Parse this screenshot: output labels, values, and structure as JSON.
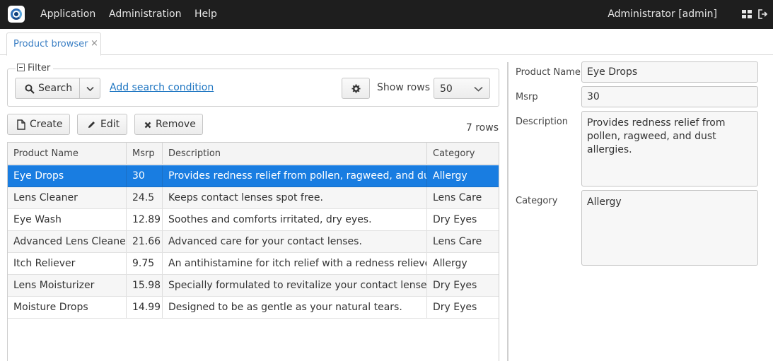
{
  "topbar": {
    "menu": [
      "Application",
      "Administration",
      "Help"
    ],
    "user": "Administrator [admin]"
  },
  "tabs": [
    {
      "label": "Product browser",
      "close": "×"
    }
  ],
  "filter": {
    "legend": "Filter",
    "search_label": "Search",
    "add_condition": "Add search condition",
    "show_rows_label": "Show rows",
    "show_rows_value": "50"
  },
  "actions": {
    "create": "Create",
    "edit": "Edit",
    "remove": "Remove"
  },
  "rows_count": "7 rows",
  "table": {
    "columns": [
      "Product Name",
      "Msrp",
      "Description",
      "Category"
    ],
    "rows": [
      [
        "Eye Drops",
        "30",
        "Provides redness relief from pollen, ragweed, and dust allergies.",
        "Allergy"
      ],
      [
        "Lens Cleaner",
        "24.5",
        "Keeps contact lenses spot free.",
        "Lens Care"
      ],
      [
        "Eye Wash",
        "12.89",
        "Soothes and comforts irritated, dry eyes.",
        "Dry Eyes"
      ],
      [
        "Advanced Lens Cleaner",
        "21.66",
        "Advanced care for your contact lenses.",
        "Lens Care"
      ],
      [
        "Itch Reliever",
        "9.75",
        "An antihistamine for itch relief with a redness reliever.",
        "Allergy"
      ],
      [
        "Lens Moisturizer",
        "15.98",
        "Specially formulated to revitalize your contact lenses.",
        "Dry Eyes"
      ],
      [
        "Moisture Drops",
        "14.99",
        "Designed to be as gentle as your natural tears.",
        "Dry Eyes"
      ]
    ],
    "selected_row": 0
  },
  "form": {
    "name_label": "Product Name",
    "name_value": "Eye Drops",
    "msrp_label": "Msrp",
    "msrp_value": "30",
    "description_label": "Description",
    "description_value": "Provides redness relief from pollen, ragweed, and dust allergies.",
    "category_label": "Category",
    "category_value": "Allergy"
  },
  "colors": {
    "topbar": "#1e1e1e",
    "accent": "#197de1",
    "link": "#1f76c2"
  }
}
